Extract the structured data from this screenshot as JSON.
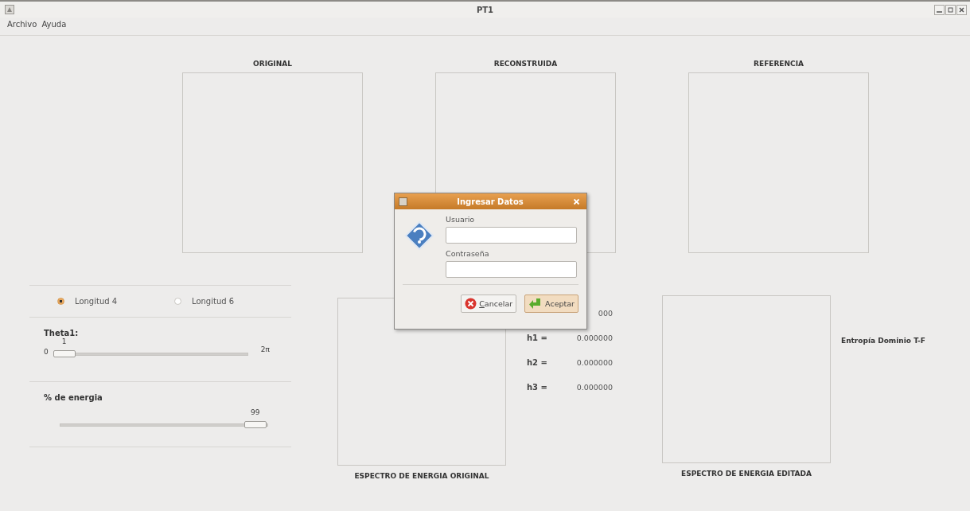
{
  "window": {
    "title": "PT1"
  },
  "menu": [
    "Archivo",
    "Ayuda"
  ],
  "images": [
    {
      "title": "ORIGINAL"
    },
    {
      "title": "RECONSTRUIDA"
    },
    {
      "title": "REFERENCIA"
    }
  ],
  "options": {
    "radios": [
      {
        "label": "Longitud 4",
        "selected": true
      },
      {
        "label": "Longitud 6",
        "selected": false
      }
    ],
    "theta": {
      "label": "Theta1:",
      "value": "1",
      "min": "0",
      "max": "2π",
      "level": 0
    },
    "energy": {
      "label": "% de energia",
      "value": "99",
      "level": 0.99
    }
  },
  "spectra": [
    {
      "title": "ESPECTRO DE ENERGIA ORIGINAL"
    },
    {
      "title": "ESPECTRO DE ENERGIA EDITADA"
    }
  ],
  "coefficients": [
    {
      "value": "000"
    },
    {
      "label": "h1 =",
      "value": "0.000000"
    },
    {
      "label": "h2 =",
      "value": "0.000000"
    },
    {
      "label": "h3 =",
      "value": "0.000000"
    }
  ],
  "entropy": {
    "label": "Entropía Dominio T-F"
  },
  "dialog": {
    "title": "Ingresar Datos",
    "fields": [
      {
        "label": "Usuario"
      },
      {
        "label": "Contraseña"
      }
    ],
    "buttons": [
      {
        "label": "Cancelar",
        "kind": "cancel",
        "default": false
      },
      {
        "label": "Aceptar",
        "kind": "ok",
        "default": true
      }
    ]
  }
}
